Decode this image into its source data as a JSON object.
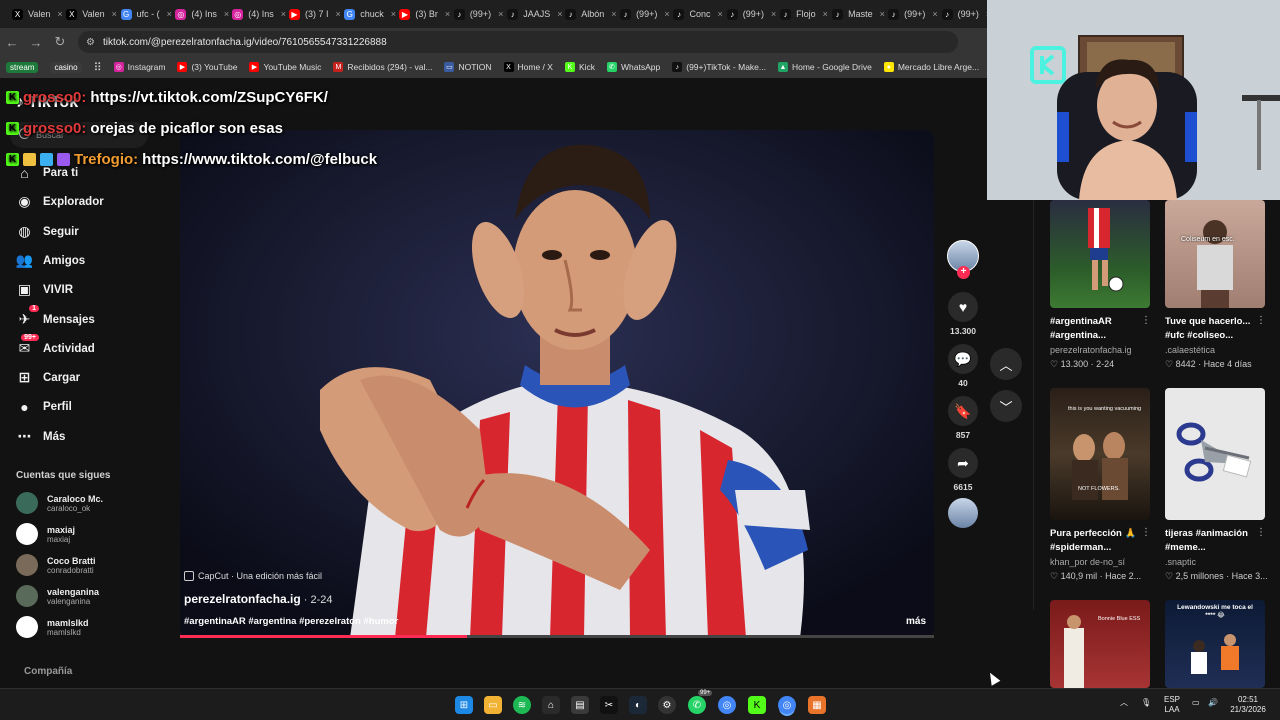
{
  "browser": {
    "tabs": [
      {
        "label": "Valen",
        "icon": "x-logo-icon",
        "color": "#000000",
        "glyph": "X"
      },
      {
        "label": "Valen",
        "icon": "x-logo-icon",
        "color": "#000000",
        "glyph": "X"
      },
      {
        "label": "ufc - (",
        "icon": "chrome-icon",
        "color": "#4285f4",
        "glyph": "G"
      },
      {
        "label": "(4) Ins",
        "icon": "instagram-icon",
        "color": "#d6249f",
        "glyph": "◎"
      },
      {
        "label": "(4) Ins",
        "icon": "instagram-icon",
        "color": "#d6249f",
        "glyph": "◎"
      },
      {
        "label": "(3) 7 I",
        "icon": "youtube-icon",
        "color": "#ff0000",
        "glyph": "▶"
      },
      {
        "label": "chuck",
        "icon": "chrome-icon",
        "color": "#4285f4",
        "glyph": "G"
      },
      {
        "label": "(3) Br",
        "icon": "youtube-icon",
        "color": "#ff0000",
        "glyph": "▶"
      },
      {
        "label": "(99+)",
        "icon": "tiktok-icon",
        "color": "#111111",
        "glyph": "♪"
      },
      {
        "label": "JAAJS",
        "icon": "tiktok-icon",
        "color": "#111111",
        "glyph": "♪"
      },
      {
        "label": "Albón",
        "icon": "tiktok-icon",
        "color": "#111111",
        "glyph": "♪"
      },
      {
        "label": "(99+)",
        "icon": "tiktok-icon",
        "color": "#111111",
        "glyph": "♪"
      },
      {
        "label": "Conc",
        "icon": "tiktok-icon",
        "color": "#111111",
        "glyph": "♪"
      },
      {
        "label": "(99+)",
        "icon": "tiktok-icon",
        "color": "#111111",
        "glyph": "♪"
      },
      {
        "label": "Flojo",
        "icon": "tiktok-icon",
        "color": "#111111",
        "glyph": "♪"
      },
      {
        "label": "Maste",
        "icon": "tiktok-icon",
        "color": "#111111",
        "glyph": "♪"
      },
      {
        "label": "(99+)",
        "icon": "tiktok-icon",
        "color": "#111111",
        "glyph": "♪"
      },
      {
        "label": "(99+)",
        "icon": "tiktok-icon",
        "color": "#111111",
        "glyph": "♪"
      }
    ],
    "url": "tiktok.com/@perezelratonfacha.ig/video/7610565547331226888",
    "bookmarks": [
      {
        "label": "stream",
        "pill": true,
        "color": "#1e7a3a"
      },
      {
        "label": "casino",
        "pill": true,
        "color": "#3a3a3a"
      },
      {
        "label": "Instagram",
        "icon": "instagram-icon",
        "color": "#d6249f",
        "glyph": "◎"
      },
      {
        "label": "(3) YouTube",
        "icon": "youtube-icon",
        "color": "#ff0000",
        "glyph": "▶"
      },
      {
        "label": "YouTube Music",
        "icon": "youtube-music-icon",
        "color": "#ff0000",
        "glyph": "▶"
      },
      {
        "label": "Recibidos (294) - val...",
        "icon": "gmail-icon",
        "color": "#c5221f",
        "glyph": "M"
      },
      {
        "label": "NOTION",
        "icon": "flag-icon",
        "color": "#3b5ba0",
        "glyph": "▭"
      },
      {
        "label": "Home / X",
        "icon": "x-logo-icon",
        "color": "#000000",
        "glyph": "X"
      },
      {
        "label": "Kick",
        "icon": "kick-icon",
        "color": "#53fc18",
        "glyph": "K"
      },
      {
        "label": "WhatsApp",
        "icon": "whatsapp-icon",
        "color": "#25d366",
        "glyph": "✆"
      },
      {
        "label": "(99+)TikTok - Make...",
        "icon": "tiktok-icon",
        "color": "#111111",
        "glyph": "♪"
      },
      {
        "label": "Home - Google Drive",
        "icon": "drive-icon",
        "color": "#1fa463",
        "glyph": "▲"
      },
      {
        "label": "Mercado Libre Arge...",
        "icon": "mercadolibre-icon",
        "color": "#ffe600",
        "glyph": "●"
      },
      {
        "label": "PROG",
        "icon": "folder-icon",
        "color": "#555555",
        "glyph": "▭"
      }
    ]
  },
  "chat": [
    {
      "user": "grosso0:",
      "message": "https://vt.tiktok.com/ZSupCY6FK/"
    },
    {
      "user": "grosso0:",
      "message": "orejas de picaflor son esas"
    },
    {
      "user": "Trefogio:",
      "message": "https://www.tiktok.com/@felbuck"
    }
  ],
  "tiktok": {
    "logo": "TikTok",
    "search_placeholder": "Buscar",
    "nav": [
      {
        "label": "Para ti",
        "icon": "home-icon",
        "glyph": "⌂"
      },
      {
        "label": "Explorador",
        "icon": "compass-icon",
        "glyph": "◉"
      },
      {
        "label": "Seguir",
        "icon": "following-icon",
        "glyph": "◍"
      },
      {
        "label": "Amigos",
        "icon": "friends-icon",
        "glyph": "👥"
      },
      {
        "label": "VIVIR",
        "icon": "live-icon",
        "glyph": "▣"
      },
      {
        "label": "Mensajes",
        "icon": "inbox-icon",
        "glyph": "✈",
        "badge": "1"
      },
      {
        "label": "Actividad",
        "icon": "activity-icon",
        "glyph": "✉",
        "badge": "99+"
      },
      {
        "label": "Cargar",
        "icon": "upload-icon",
        "glyph": "⊞"
      },
      {
        "label": "Perfil",
        "icon": "profile-icon",
        "glyph": "●"
      },
      {
        "label": "Más",
        "icon": "more-icon",
        "glyph": "⋯"
      }
    ],
    "following_title": "Cuentas que sigues",
    "following": [
      {
        "name": "Caraloco Mc.",
        "handle": "caraloco_ok"
      },
      {
        "name": "maxiaj",
        "handle": "maxiaj"
      },
      {
        "name": "Coco Bratti",
        "handle": "conradobratti"
      },
      {
        "name": "valenganina",
        "handle": "valenganina"
      },
      {
        "name": "mamlslkd",
        "handle": "mamlslkd"
      }
    ],
    "footer": "Compañía",
    "video": {
      "capcut": "CapCut · Una edición más fácil",
      "author": "perezelratonfacha.ig",
      "date": " · 2-24",
      "tags": "#argentinaAR #argentina #perezelraton #humor",
      "more": "más",
      "progress": 0.38
    },
    "actions": {
      "likes": "13.300",
      "comments": "40",
      "saves": "857",
      "shares": "6615"
    },
    "related": [
      {
        "caption": "#argentinaAR #argentina...",
        "author": "perezelratonfacha.ig",
        "stats": "♡ 13.300 · 2-24"
      },
      {
        "caption": "Tuve que hacerlo... #ufc #coliseo...",
        "author": ".calaestética",
        "stats": "♡ 8442 · Hace 4 días"
      },
      {
        "caption": "Pura perfección 🙏 #spiderman...",
        "author": "khan_por de-no_sí",
        "stats": "♡ 140,9 mil · Hace 2..."
      },
      {
        "caption": "tijeras #animación #meme...",
        "author": ".snaptic",
        "stats": "♡ 2,5 millones · Hace 3..."
      },
      {
        "caption": "",
        "author": "",
        "stats": ""
      },
      {
        "caption": "Lewandowski me toca el **** 😂",
        "author": "",
        "stats": ""
      }
    ],
    "thumb_texts": {
      "t2": "Coliseum en esc.",
      "t3_top": "this is you wanting vacuuming",
      "t3_bottom": "NOT FLOWERS.",
      "t5": "Bonnie Blue ESS",
      "t6": "Lewandowski me toca el **** 😂"
    }
  },
  "taskbar": {
    "lang_top": "ESP",
    "lang_bottom": "LAA",
    "time": "02:51",
    "date": "21/3/2026",
    "whatsapp_badge": "99+"
  }
}
